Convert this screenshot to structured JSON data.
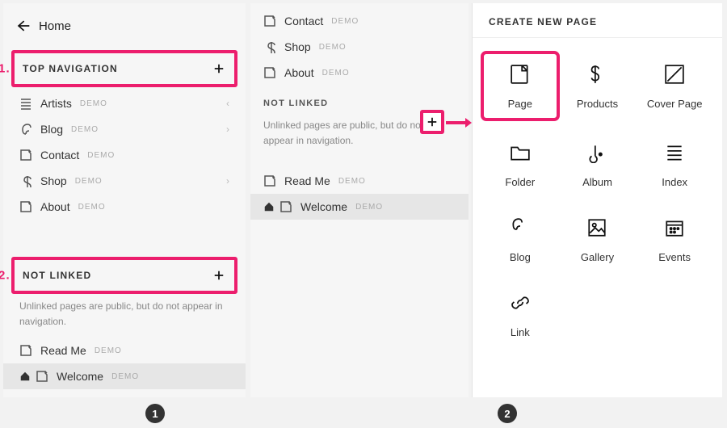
{
  "left": {
    "home": "Home",
    "sections": {
      "top": {
        "title": "TOP NAVIGATION",
        "callout": "1.",
        "items": [
          {
            "icon": "lines",
            "label": "Artists",
            "demo": "DEMO",
            "chev": "left"
          },
          {
            "icon": "blog",
            "label": "Blog",
            "demo": "DEMO",
            "chev": "right"
          },
          {
            "icon": "page",
            "label": "Contact",
            "demo": "DEMO"
          },
          {
            "icon": "dollar",
            "label": "Shop",
            "demo": "DEMO",
            "chev": "right"
          },
          {
            "icon": "page",
            "label": "About",
            "demo": "DEMO"
          }
        ]
      },
      "notlinked": {
        "title": "NOT LINKED",
        "callout": "2.",
        "desc": "Unlinked pages are public, but do not appear in navigation.",
        "items": [
          {
            "icon": "page",
            "label": "Read Me",
            "demo": "DEMO"
          },
          {
            "icon": "page",
            "label": "Welcome",
            "demo": "DEMO",
            "home": true,
            "selected": true
          }
        ]
      }
    }
  },
  "mid": {
    "top_items": [
      {
        "icon": "page",
        "label": "Contact",
        "demo": "DEMO"
      },
      {
        "icon": "dollar",
        "label": "Shop",
        "demo": "DEMO"
      },
      {
        "icon": "page",
        "label": "About",
        "demo": "DEMO"
      }
    ],
    "notlinked": {
      "title": "NOT LINKED",
      "desc": "Unlinked pages are public, but do not appear in navigation.",
      "items": [
        {
          "icon": "page",
          "label": "Read Me",
          "demo": "DEMO"
        },
        {
          "icon": "page",
          "label": "Welcome",
          "demo": "DEMO",
          "home": true,
          "selected": true
        }
      ]
    }
  },
  "right": {
    "title": "CREATE NEW PAGE",
    "tiles": [
      {
        "icon": "page",
        "label": "Page",
        "highlight": true
      },
      {
        "icon": "dollar",
        "label": "Products"
      },
      {
        "icon": "cover",
        "label": "Cover Page"
      },
      {
        "icon": "folder",
        "label": "Folder"
      },
      {
        "icon": "album",
        "label": "Album"
      },
      {
        "icon": "index",
        "label": "Index"
      },
      {
        "icon": "blog",
        "label": "Blog"
      },
      {
        "icon": "gallery",
        "label": "Gallery"
      },
      {
        "icon": "events",
        "label": "Events"
      },
      {
        "icon": "link",
        "label": "Link"
      }
    ]
  },
  "badges": {
    "one": "1",
    "two": "2"
  }
}
